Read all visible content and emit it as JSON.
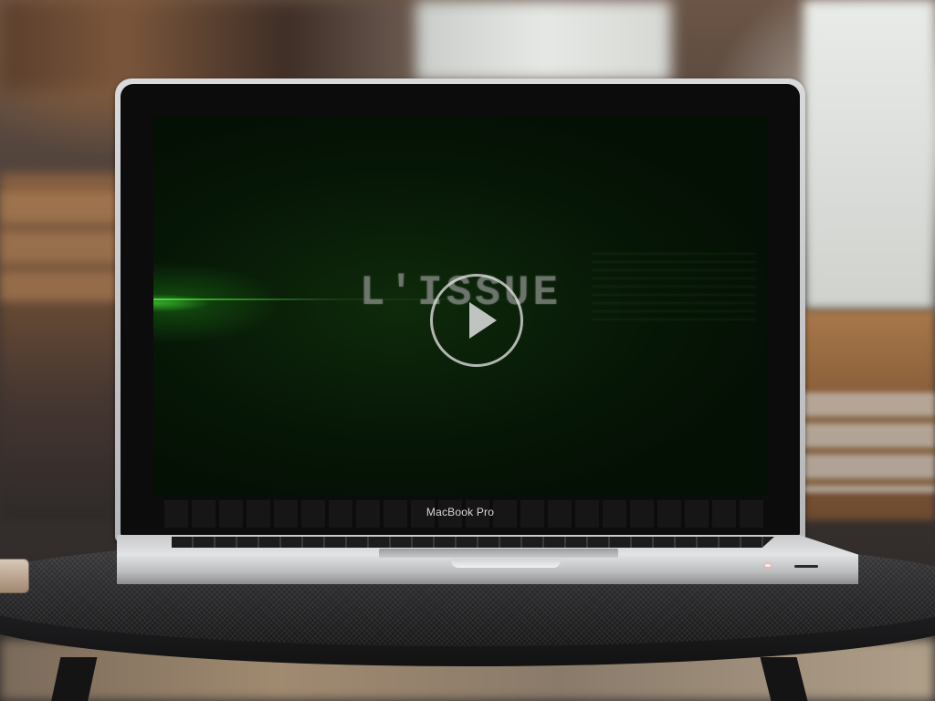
{
  "video": {
    "title": "L'ISSUE",
    "play_icon": "play-icon",
    "accent_color": "#3aff2a"
  },
  "device": {
    "label": "MacBook Pro"
  }
}
